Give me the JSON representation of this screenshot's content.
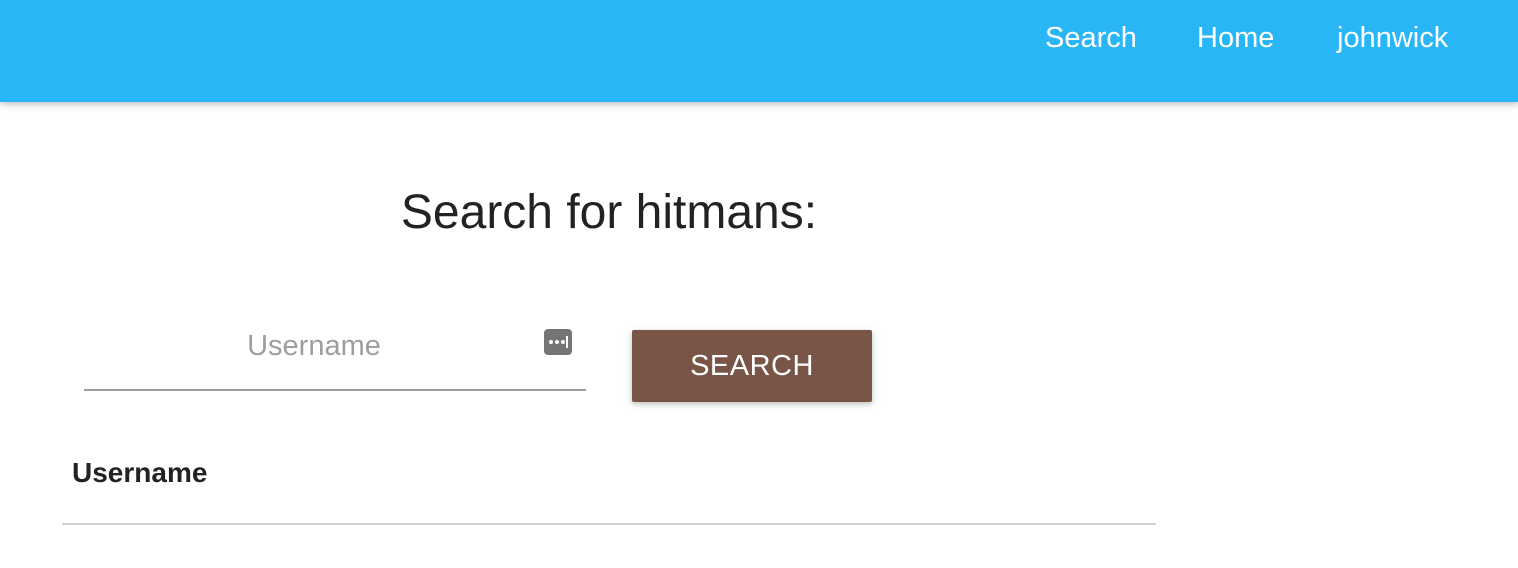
{
  "navbar": {
    "background": "#29b6f6",
    "links": [
      {
        "label": "Search"
      },
      {
        "label": "Home"
      },
      {
        "label": "johnwick"
      }
    ]
  },
  "main": {
    "title": "Search for hitmans:",
    "search_input": {
      "value": "",
      "placeholder": "Username",
      "trailing_icon": "password-manager-icon"
    },
    "search_button": {
      "label": "SEARCH",
      "color": "#795548"
    },
    "results_table": {
      "columns": [
        "Username"
      ],
      "rows": []
    }
  }
}
